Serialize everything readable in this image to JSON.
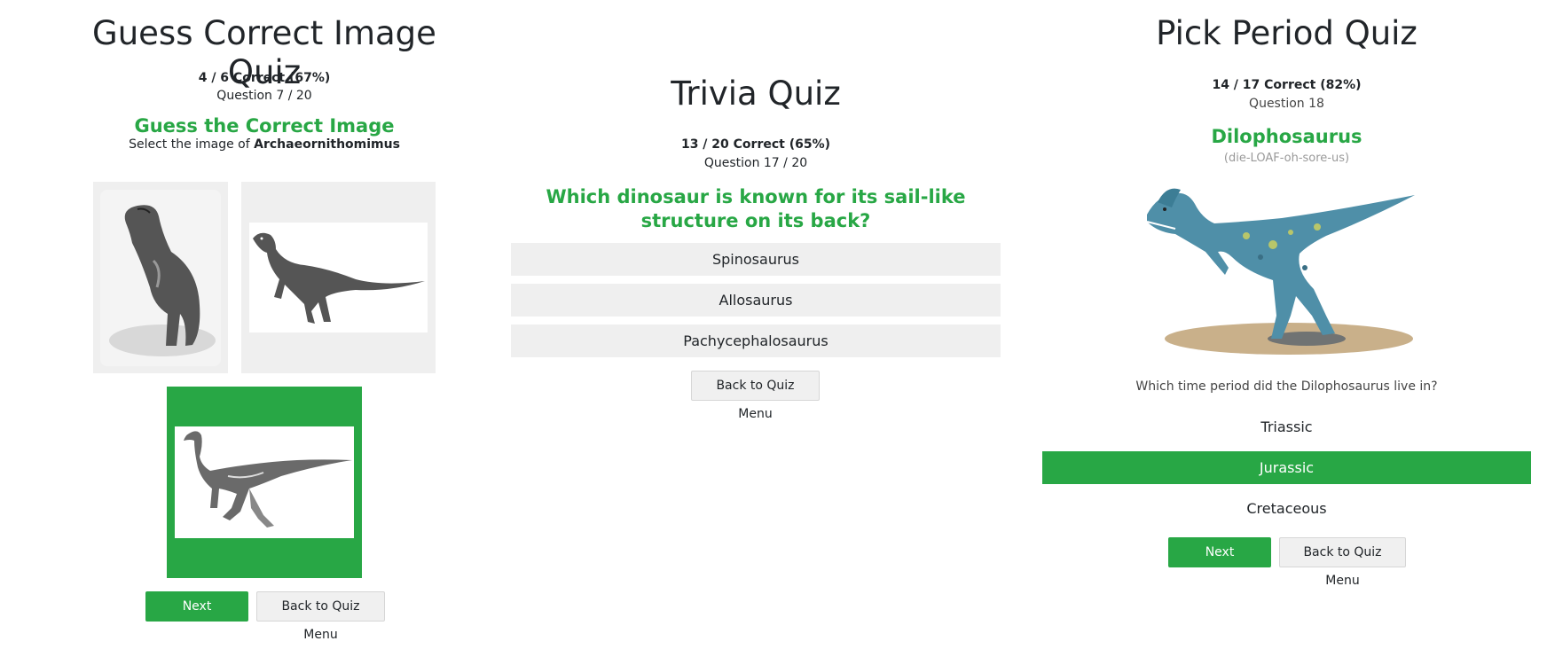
{
  "image_quiz": {
    "title": "Guess Correct Image Quiz",
    "score": "4 / 6 Correct (67%)",
    "question": "Question 7 / 20",
    "heading": "Guess the Correct Image",
    "prompt_prefix": "Select the image of ",
    "prompt_name": "Archaeornithomimus",
    "next_label": "Next Question",
    "back_label": "Back to Quiz Menu",
    "accent_color": "#28a745"
  },
  "trivia_quiz": {
    "title": "Trivia Quiz",
    "score": "13 / 20 Correct (65%)",
    "question": "Question 17 / 20",
    "question_text": "Which dinosaur is known for its sail-like structure on its back?",
    "answers": [
      "Spinosaurus",
      "Allosaurus",
      "Pachycephalosaurus"
    ],
    "back_label": "Back to Quiz Menu"
  },
  "period_quiz": {
    "title": "Pick Period Quiz",
    "score": "14 / 17 Correct (82%)",
    "question": "Question 18",
    "dino_name": "Dilophosaurus",
    "pronunciation": "(die-LOAF-oh-sore-us)",
    "prompt": "Which time period did the Dilophosaurus live in?",
    "options": [
      "Triassic",
      "Jurassic",
      "Cretaceous"
    ],
    "selected": "Jurassic",
    "next_label": "Next Question",
    "back_label": "Back to Quiz Menu"
  }
}
